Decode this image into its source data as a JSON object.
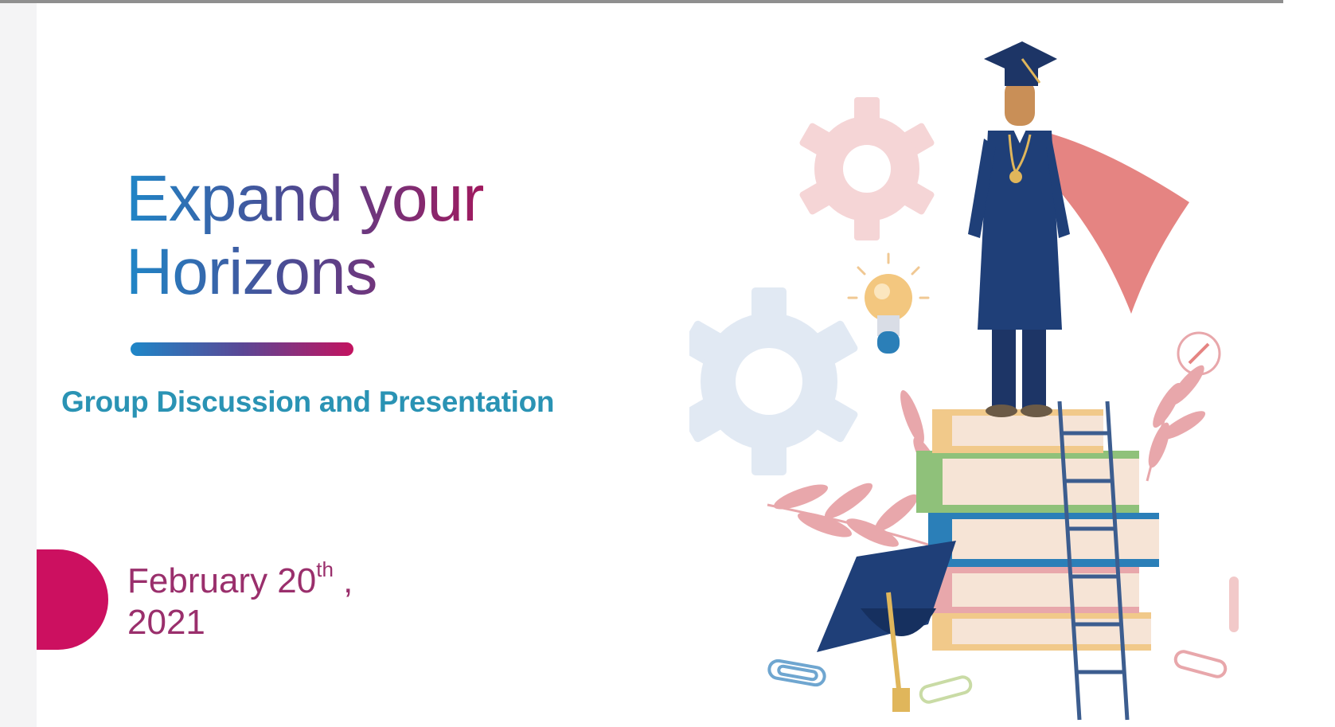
{
  "slide": {
    "title_line1": "Expand your",
    "title_line2": "Horizons",
    "subtitle": "Group Discussion and Presentation",
    "date_month_day": "February 20",
    "date_suffix": "th",
    "date_comma": " ,",
    "date_year": "2021"
  },
  "colors": {
    "title_gradient_start": "#1f86c7",
    "title_gradient_end": "#a0195e",
    "subtitle": "#2a93b4",
    "date": "#9a2f6c",
    "accent_half_circle": "#cc1060",
    "graduate_gown": "#1f3f78",
    "cape": "#e58482"
  },
  "illustration": {
    "icons": [
      "gear-icon",
      "lightbulb-icon",
      "graduate-figure",
      "book-stack",
      "ladder",
      "mortarboard-icon",
      "paper-clip-icon",
      "leaf-branch"
    ]
  }
}
